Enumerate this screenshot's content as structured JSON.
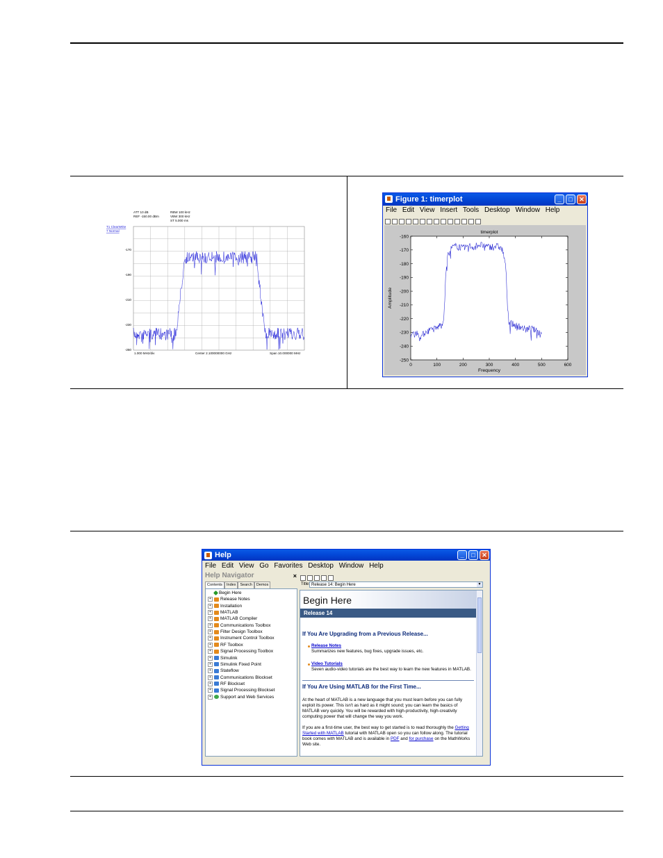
{
  "spectrum_analyzer": {
    "att": "ATT 10 dB",
    "ref": "REF -150.00 dBm",
    "rbw": "RBW 100 kHz",
    "vbw": "VBW 300 kHz",
    "st": "ST   5.000 ms",
    "trace": "T1 ClearWrite",
    "detector": "7 Normal",
    "y_ticks": [
      "-170",
      "-190",
      "-210",
      "-230",
      "-250"
    ],
    "x_left": "1.000 MHz/div",
    "x_center": "Center 2.100000000 GHz",
    "x_right": "Span 10.000000 MHz",
    "trace_color": "#1a1ad8"
  },
  "figure_window": {
    "title": "Figure 1: timerplot",
    "menu": [
      "File",
      "Edit",
      "View",
      "Insert",
      "Tools",
      "Desktop",
      "Window",
      "Help"
    ],
    "title_bar_color": "#0346d6"
  },
  "chart_data": {
    "type": "line",
    "title": "timerplot",
    "xlabel": "Frequency",
    "ylabel": "Amplitude",
    "xlim": [
      0,
      600
    ],
    "ylim": [
      -250,
      -160
    ],
    "x_ticks": [
      0,
      100,
      200,
      300,
      400,
      500,
      600
    ],
    "y_ticks": [
      -160,
      -170,
      -180,
      -190,
      -200,
      -210,
      -220,
      -230,
      -240,
      -250
    ],
    "grid": false,
    "series": [
      {
        "x": [
          0,
          20,
          40,
          60,
          80,
          100,
          115,
          125,
          130,
          135,
          140,
          145,
          150,
          160,
          180,
          200,
          220,
          240,
          260,
          280,
          300,
          320,
          340,
          350,
          360,
          365,
          370,
          375,
          380,
          400,
          420,
          440,
          460,
          480,
          500
        ],
        "values": [
          -232,
          -230,
          -233,
          -229,
          -228,
          -227,
          -224,
          -222,
          -205,
          -185,
          -175,
          -172,
          -170,
          -168,
          -167,
          -169,
          -167,
          -168,
          -166,
          -167,
          -168,
          -167,
          -168,
          -170,
          -178,
          -190,
          -210,
          -222,
          -223,
          -225,
          -226,
          -228,
          -227,
          -229,
          -231
        ]
      }
    ]
  },
  "help_window": {
    "title": "Help",
    "menu": [
      "File",
      "Edit",
      "View",
      "Go",
      "Favorites",
      "Desktop",
      "Window",
      "Help"
    ],
    "navigator_title": "Help Navigator",
    "navigator_close": "×",
    "tabs": [
      "Contents",
      "Index",
      "Search",
      "Demos"
    ],
    "nav_items": [
      {
        "label": "Begin Here",
        "icon": "diamond"
      },
      {
        "label": "Release Notes",
        "icon": "book"
      },
      {
        "label": "Installation",
        "icon": "book"
      },
      {
        "label": "MATLAB",
        "icon": "book"
      },
      {
        "label": "MATLAB Compiler",
        "icon": "book"
      },
      {
        "label": "Communications Toolbox",
        "icon": "book"
      },
      {
        "label": "Filter Design Toolbox",
        "icon": "book"
      },
      {
        "label": "Instrument Control Toolbox",
        "icon": "book"
      },
      {
        "label": "RF Toolbox",
        "icon": "book"
      },
      {
        "label": "Signal Processing Toolbox",
        "icon": "book"
      },
      {
        "label": "Simulink",
        "icon": "book-blue"
      },
      {
        "label": "Simulink Fixed Point",
        "icon": "book-blue"
      },
      {
        "label": "Stateflow",
        "icon": "book-blue"
      },
      {
        "label": "Communications Blockset",
        "icon": "book-blue"
      },
      {
        "label": "RF Blockset",
        "icon": "book-blue"
      },
      {
        "label": "Signal Processing Blockset",
        "icon": "book-blue"
      },
      {
        "label": "Support and Web Services",
        "icon": "globe"
      }
    ],
    "title_label": "Title:",
    "title_value": "Release 14: Begin Here",
    "page_heading": "Begin Here",
    "release_banner": "Release 14",
    "section1_heading": "If You Are Upgrading from a Previous Release...",
    "release_notes_link": "Release Notes",
    "release_notes_desc": "Summarizes new features, bug fixes, upgrade issues, etc.",
    "video_link": "Video Tutorials",
    "video_desc": "Seven audio-video tutorials are the best way to learn the new features in MATLAB.",
    "section2_heading": "If You Are Using MATLAB for the First Time...",
    "para1": "At the heart of MATLAB is a new language that you must learn before you can fully exploit its power. This isn't as hard as it might sound; you can learn the basics of MATLAB very quickly. You will be rewarded with high-productivity, high-creativity computing power that will change the way you work.",
    "para2_a": "If you are a first-time user, the best way to get started is to read thoroughly the ",
    "para2_link1": "Getting Started with MATLAB",
    "para2_b": " tutorial with MATLAB open so you can follow along. The tutorial book comes with MATLAB and is available in ",
    "para2_link2": "PDF",
    "para2_c": " and ",
    "para2_link3": "for purchase",
    "para2_d": " on the MathWorks Web site."
  }
}
